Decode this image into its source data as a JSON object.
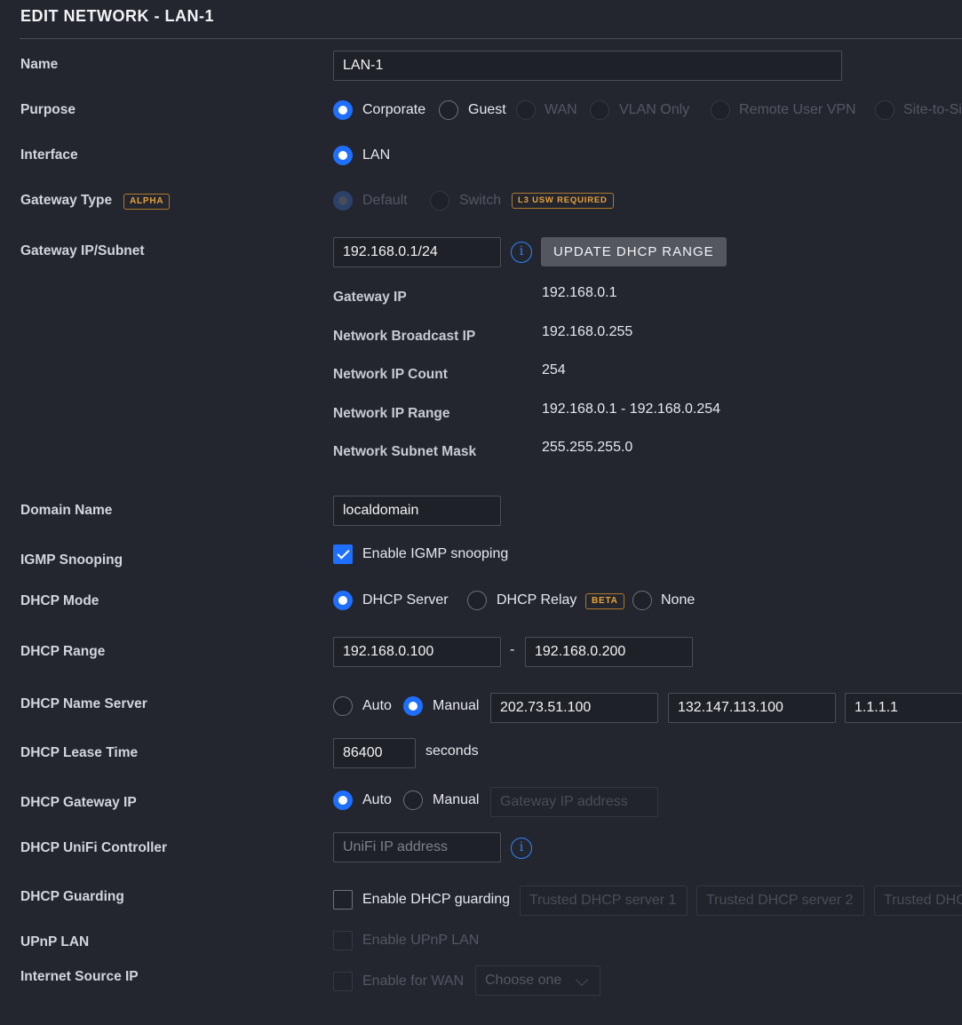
{
  "title": "EDIT NETWORK - LAN-1",
  "name": {
    "label": "Name",
    "value": "LAN-1"
  },
  "purpose": {
    "label": "Purpose",
    "options": [
      "Corporate",
      "Guest",
      "WAN",
      "VLAN Only",
      "Remote User VPN",
      "Site-to-Si"
    ],
    "selected": "Corporate"
  },
  "interface": {
    "label": "Interface",
    "option": "LAN"
  },
  "gateway_type": {
    "label": "Gateway Type",
    "badge": "ALPHA",
    "options": [
      "Default",
      "Switch"
    ],
    "switch_badge": "L3 USW REQUIRED"
  },
  "gateway_subnet": {
    "label": "Gateway IP/Subnet",
    "value": "192.168.0.1/24",
    "info_icon": "i",
    "update_button": "UPDATE DHCP RANGE",
    "details": [
      {
        "label": "Gateway IP",
        "value": "192.168.0.1"
      },
      {
        "label": "Network Broadcast IP",
        "value": "192.168.0.255"
      },
      {
        "label": "Network IP Count",
        "value": "254"
      },
      {
        "label": "Network IP Range",
        "value": "192.168.0.1 - 192.168.0.254"
      },
      {
        "label": "Network Subnet Mask",
        "value": "255.255.255.0"
      }
    ]
  },
  "domain_name": {
    "label": "Domain Name",
    "value": "localdomain"
  },
  "igmp": {
    "label": "IGMP Snooping",
    "checkbox_label": "Enable IGMP snooping",
    "checked": true
  },
  "dhcp_mode": {
    "label": "DHCP Mode",
    "options": [
      "DHCP Server",
      "DHCP Relay",
      "None"
    ],
    "relay_badge": "BETA",
    "selected": "DHCP Server"
  },
  "dhcp_range": {
    "label": "DHCP Range",
    "start": "192.168.0.100",
    "separator": "-",
    "end": "192.168.0.200"
  },
  "dhcp_name_server": {
    "label": "DHCP Name Server",
    "options": [
      "Auto",
      "Manual"
    ],
    "selected": "Manual",
    "servers": [
      "202.73.51.100",
      "132.147.113.100",
      "1.1.1.1"
    ]
  },
  "dhcp_lease_time": {
    "label": "DHCP Lease Time",
    "value": "86400",
    "unit": "seconds"
  },
  "dhcp_gateway_ip": {
    "label": "DHCP Gateway IP",
    "options": [
      "Auto",
      "Manual"
    ],
    "selected": "Auto",
    "placeholder": "Gateway IP address"
  },
  "dhcp_unifi_controller": {
    "label": "DHCP UniFi Controller",
    "placeholder": "UniFi IP address",
    "info_icon": "i"
  },
  "dhcp_guarding": {
    "label": "DHCP Guarding",
    "checkbox_label": "Enable DHCP guarding",
    "placeholders": [
      "Trusted DHCP server 1",
      "Trusted DHCP server 2",
      "Trusted DHC"
    ]
  },
  "upnp_lan": {
    "label": "UPnP LAN",
    "checkbox_label": "Enable UPnP LAN"
  },
  "internet_source_ip": {
    "label": "Internet Source IP",
    "checkbox_label": "Enable for WAN",
    "select_value": "Choose one"
  }
}
